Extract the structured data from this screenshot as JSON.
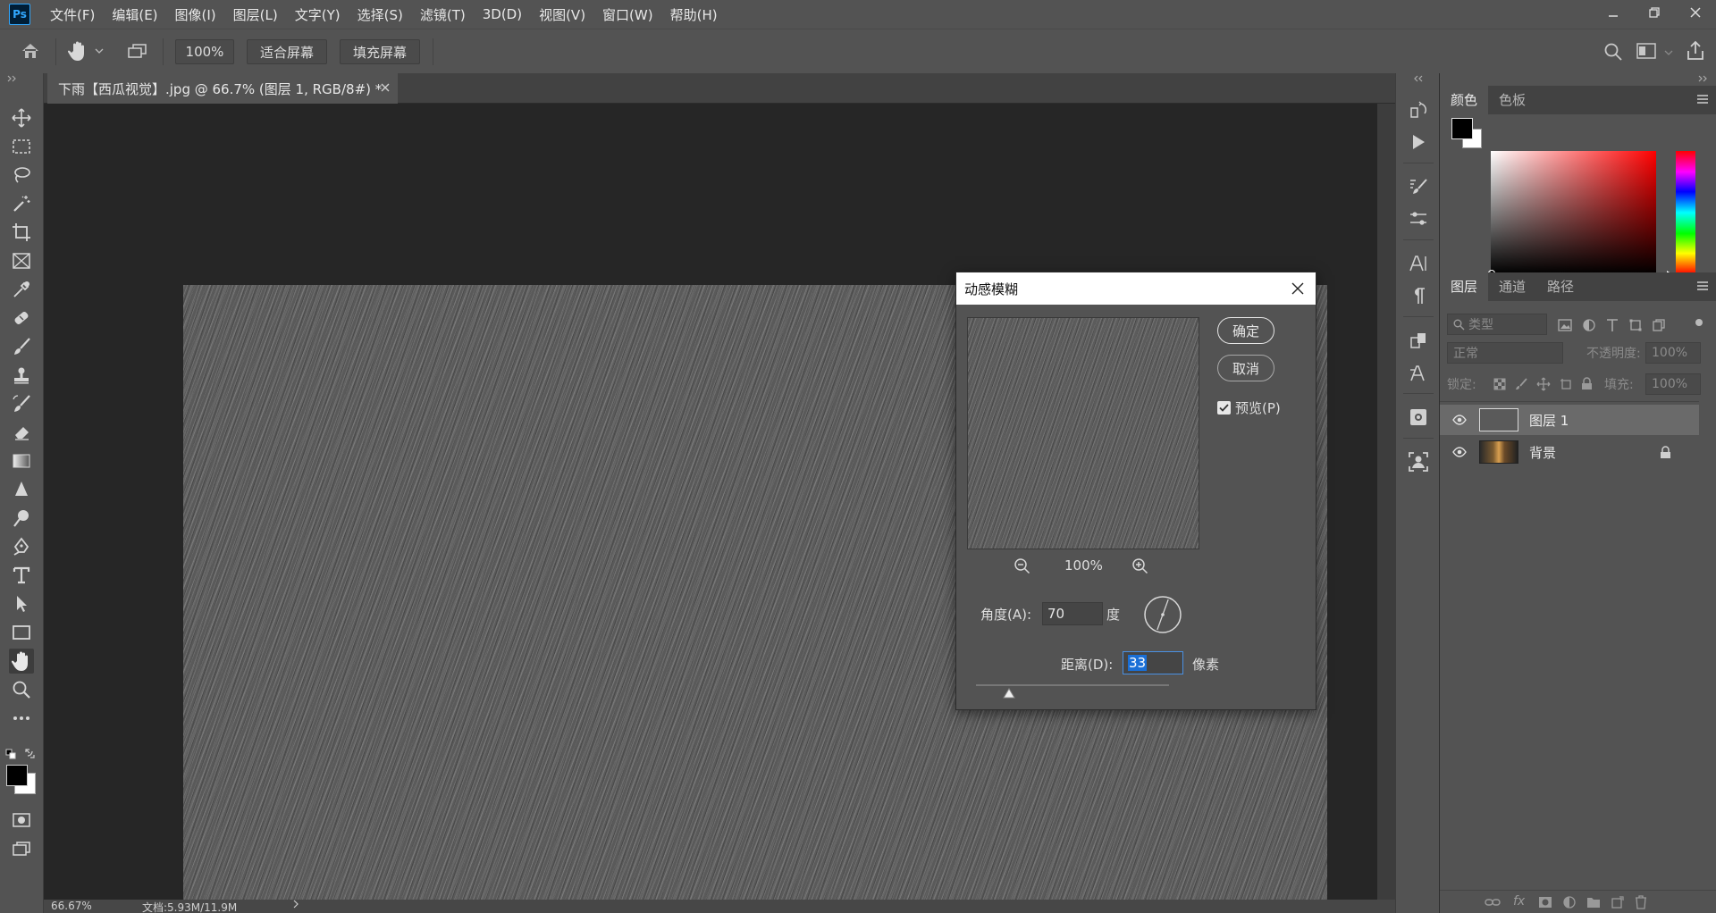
{
  "app": {
    "logo_text": "Ps"
  },
  "menu": [
    {
      "label": "文件(F)"
    },
    {
      "label": "编辑(E)"
    },
    {
      "label": "图像(I)"
    },
    {
      "label": "图层(L)"
    },
    {
      "label": "文字(Y)"
    },
    {
      "label": "选择(S)"
    },
    {
      "label": "滤镜(T)"
    },
    {
      "label": "3D(D)"
    },
    {
      "label": "视图(V)"
    },
    {
      "label": "窗口(W)"
    },
    {
      "label": "帮助(H)"
    }
  ],
  "options_bar": {
    "zoom_value": "100%",
    "fit_screen_label": "适合屏幕",
    "fill_screen_label": "填充屏幕"
  },
  "document": {
    "tab_title": "下雨【西瓜视觉】.jpg @ 66.7% (图层 1, RGB/8#) *",
    "status_zoom": "66.67%",
    "status_doc": "文档:5.93M/11.9M"
  },
  "color_panel": {
    "tabs": [
      {
        "label": "颜色"
      },
      {
        "label": "色板"
      }
    ],
    "foreground": "#000000",
    "background": "#ffffff"
  },
  "layers_panel": {
    "tabs": [
      {
        "label": "图层"
      },
      {
        "label": "通道"
      },
      {
        "label": "路径"
      }
    ],
    "filter_placeholder": "类型",
    "blend_mode": "正常",
    "opacity_label": "不透明度:",
    "opacity_value": "100%",
    "lock_label": "锁定:",
    "fill_label": "填充:",
    "fill_value": "100%",
    "layers": [
      {
        "name": "图层 1",
        "selected": true,
        "locked": false
      },
      {
        "name": "背景",
        "selected": false,
        "locked": true
      }
    ]
  },
  "dialog": {
    "title": "动感模糊",
    "ok_label": "确定",
    "cancel_label": "取消",
    "preview_label": "预览(P)",
    "preview_checked": true,
    "preview_zoom": "100%",
    "angle_label": "角度(A):",
    "angle_value": "70",
    "angle_unit": "度",
    "distance_label": "距离(D):",
    "distance_value": "33",
    "distance_unit": "像素",
    "distance_fraction": 0.17
  }
}
